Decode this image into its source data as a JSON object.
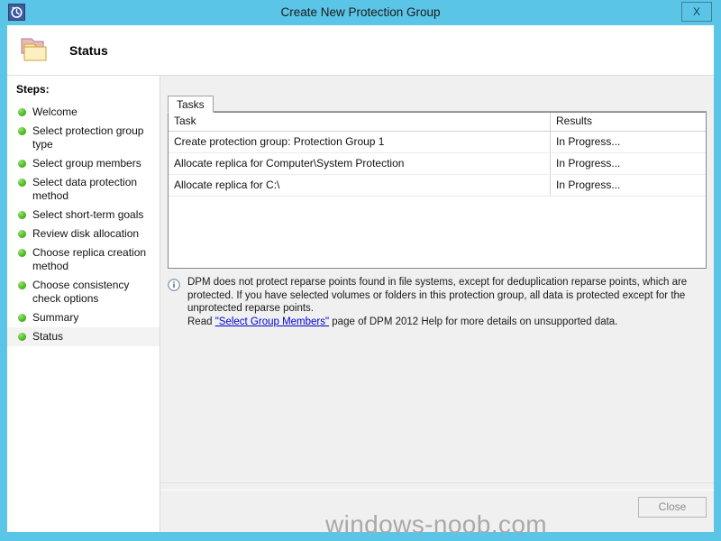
{
  "window": {
    "title": "Create New Protection Group",
    "icon": "clock-recovery-icon",
    "close_label": "X",
    "frame_color": "#5bc5e8"
  },
  "header": {
    "title": "Status",
    "icon": "folder-icon"
  },
  "sidebar": {
    "label": "Steps:",
    "items": [
      {
        "label": "Welcome",
        "state": "done"
      },
      {
        "label": "Select protection group type",
        "state": "done"
      },
      {
        "label": "Select group members",
        "state": "done"
      },
      {
        "label": "Select data protection method",
        "state": "done"
      },
      {
        "label": "Select short-term goals",
        "state": "done"
      },
      {
        "label": "Review disk allocation",
        "state": "done"
      },
      {
        "label": "Choose replica creation method",
        "state": "done"
      },
      {
        "label": "Choose consistency check options",
        "state": "done"
      },
      {
        "label": "Summary",
        "state": "done"
      },
      {
        "label": "Status",
        "state": "current"
      }
    ]
  },
  "main": {
    "tabs": [
      {
        "label": "Tasks",
        "selected": true
      }
    ],
    "table": {
      "columns": [
        "Task",
        "Results"
      ],
      "rows": [
        {
          "task": "Create protection group: Protection Group 1",
          "result": "In Progress..."
        },
        {
          "task": "Allocate replica for Computer\\System Protection",
          "result": "In Progress..."
        },
        {
          "task": "Allocate replica for C:\\",
          "result": "In Progress..."
        }
      ]
    },
    "info": {
      "icon": "information-icon",
      "line1": "DPM does not protect reparse points found in file systems, except for deduplication reparse points, which are protected. If you have selected volumes or folders in this protection group, all data is protected except for the unprotected reparse points.",
      "line2_prefix": "Read ",
      "link_text": "\"Select Group Members\"",
      "line2_suffix": " page of DPM 2012 Help for more details on unsupported data.",
      "link_color": "#0000cd"
    }
  },
  "footer": {
    "close_label": "Close",
    "close_enabled": false
  },
  "watermark": {
    "text": "windows-noob.com",
    "color": "#a9a9a9"
  }
}
